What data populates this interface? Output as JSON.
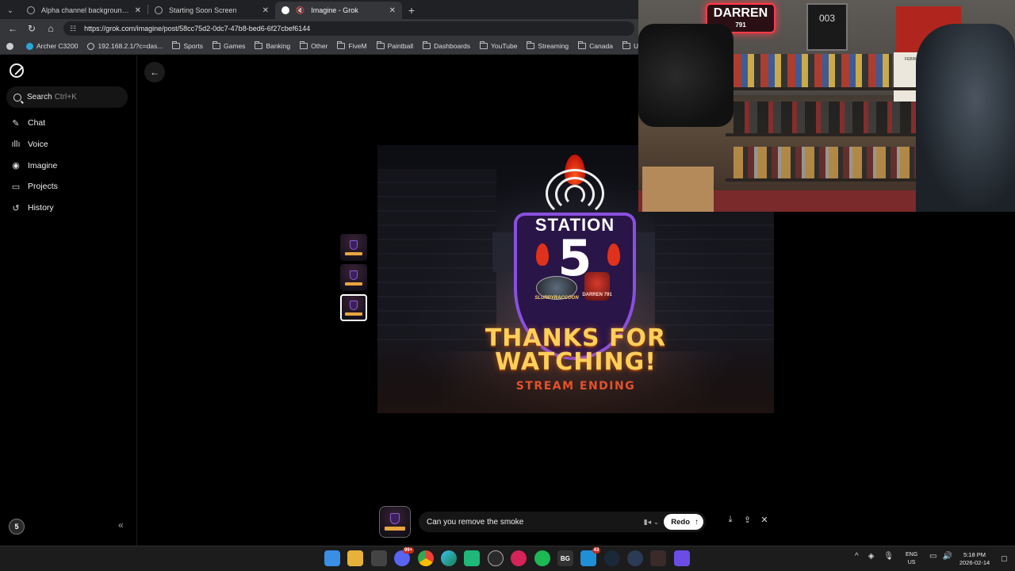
{
  "browser": {
    "tabs": [
      {
        "title": "Alpha channel background remover",
        "active": false
      },
      {
        "title": "Starting Soon Screen",
        "active": false
      },
      {
        "title": "Imagine - Grok",
        "active": true
      }
    ],
    "url": "https://grok.com/imagine/post/58cc75d2-0dc7-47b8-bed6-6f27cbef6144",
    "bookmarks": [
      "Archer C3200",
      "192.168.2.1/?c=das...",
      "Sports",
      "Games",
      "Banking",
      "Other",
      "FiveM",
      "Paintball",
      "Dashboards",
      "YouTube",
      "Streaming",
      "Canada",
      "USA"
    ]
  },
  "sidebar": {
    "search_label": "Search",
    "search_shortcut": "Ctrl+K",
    "items": [
      {
        "label": "Chat",
        "icon": "edit-icon"
      },
      {
        "label": "Voice",
        "icon": "waveform-icon"
      },
      {
        "label": "Imagine",
        "icon": "image-icon"
      },
      {
        "label": "Projects",
        "icon": "folder-icon"
      },
      {
        "label": "History",
        "icon": "history-icon"
      }
    ],
    "avatar_text": "5"
  },
  "poster": {
    "station": "STATION",
    "number": "5",
    "left_logo": "SLURPYRACCOON",
    "right_logo": "DARREN 791",
    "line1": "THANKS FOR",
    "line2": "WATCHING!",
    "line3": "STREAM ENDING"
  },
  "prompt": {
    "text": "Can you remove the smoke",
    "redo_label": "Redo"
  },
  "webcam": {
    "neon_sign": "DARREN",
    "neon_num": "791",
    "frame_text": "003",
    "calendar": "FEBRUARY"
  },
  "taskbar": {
    "badges": {
      "discord": "99+",
      "mail": "43"
    },
    "bg_label": "BG",
    "lang_top": "ENG",
    "lang_bottom": "US",
    "time": "5:18 PM",
    "date": "2026-02-14"
  },
  "colors": {
    "accent_purple": "#8a4fe0",
    "poster_gold": "#ffcf5a",
    "stream_red": "#e8502a",
    "browser_bg": "#35363a"
  }
}
